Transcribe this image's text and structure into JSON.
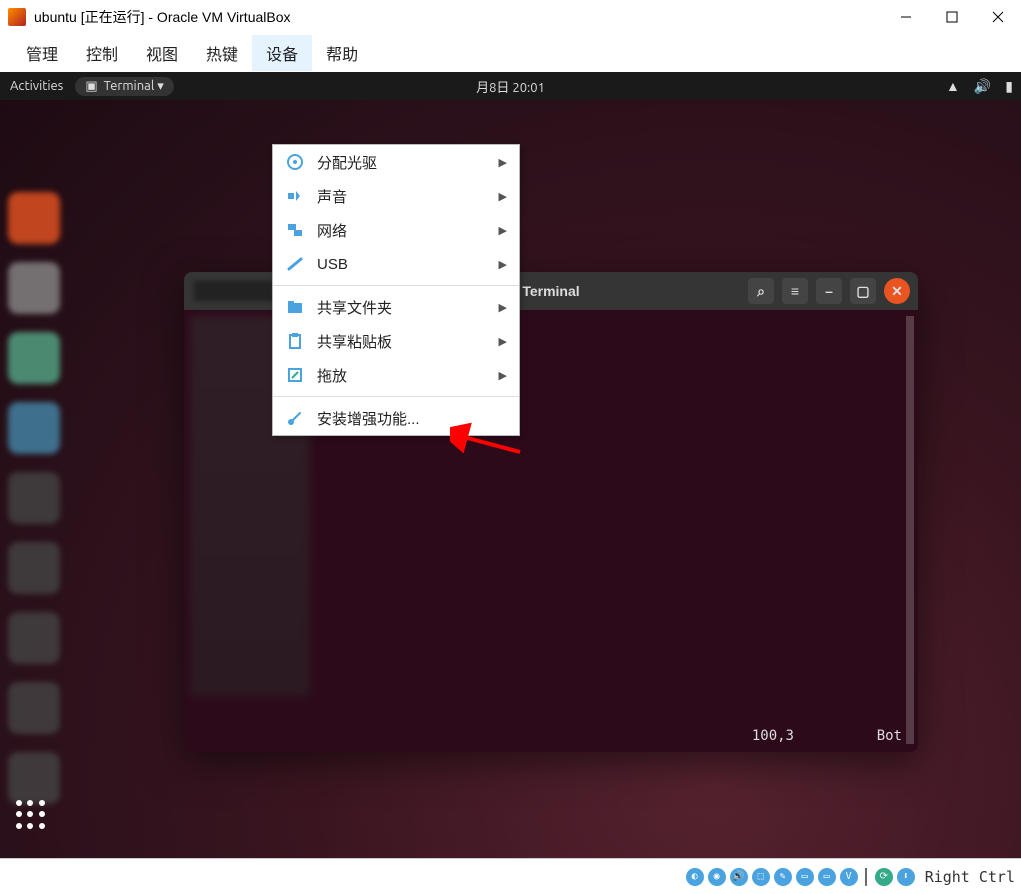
{
  "window": {
    "title": "ubuntu [正在运行] - Oracle VM VirtualBox"
  },
  "host_menu": {
    "items": [
      "管理",
      "控制",
      "视图",
      "热键",
      "设备",
      "帮助"
    ],
    "active_index": 4
  },
  "dropdown": {
    "items": [
      {
        "icon": "disc",
        "label": "分配光驱",
        "submenu": true
      },
      {
        "icon": "audio",
        "label": "声音",
        "submenu": true
      },
      {
        "icon": "network",
        "label": "网络",
        "submenu": true
      },
      {
        "icon": "usb",
        "label": "USB",
        "submenu": true
      },
      {
        "separator": true
      },
      {
        "icon": "folder",
        "label": "共享文件夹",
        "submenu": true
      },
      {
        "icon": "clipboard",
        "label": "共享粘贴板",
        "submenu": true
      },
      {
        "icon": "drag",
        "label": "拖放",
        "submenu": true
      },
      {
        "separator": true
      },
      {
        "icon": "install",
        "label": "安装增强功能...",
        "submenu": false
      }
    ]
  },
  "ubuntu_bar": {
    "activities": "Activities",
    "appmenu": "Terminal ▾",
    "clock": "月8日  20:01"
  },
  "terminal": {
    "title": "Terminal",
    "status_pos": "100,3",
    "status_right": "Bot"
  },
  "statusbar": {
    "host_key": "Right Ctrl"
  }
}
